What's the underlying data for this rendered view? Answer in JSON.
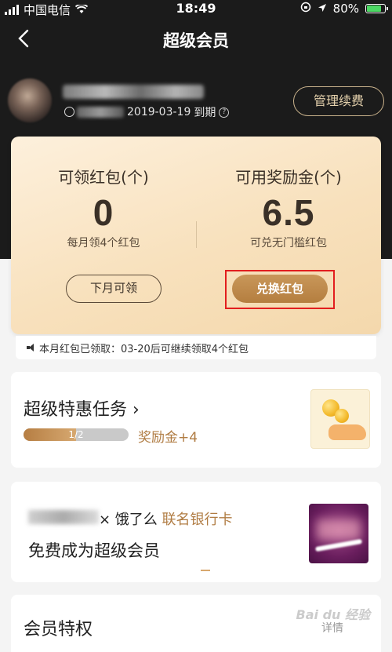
{
  "status_bar": {
    "carrier": "中国电信",
    "time": "18:49",
    "battery": "80%"
  },
  "nav": {
    "title": "超级会员"
  },
  "profile": {
    "expire_date": "2019-03-19",
    "expire_suffix": "到期",
    "manage_label": "管理续费"
  },
  "benefits": {
    "red_packets": {
      "title": "可领红包(个)",
      "value": "0",
      "subtitle": "每月领4个红包",
      "button": "下月可领"
    },
    "bonus": {
      "title": "可用奖励金(个)",
      "value": "6.5",
      "subtitle": "可兑无门槛红包",
      "button": "兑换红包"
    },
    "notice": "本月红包已领取：03-20后可继续领取4个红包"
  },
  "tasks": {
    "title": "超级特惠任务",
    "progress_label": "1/2",
    "progress_fraction": 0.5,
    "reward": "奖励金+4"
  },
  "bank": {
    "middle": "× 饿了么",
    "highlight": "联名银行卡",
    "subtitle": "免费成为超级会员"
  },
  "privileges": {
    "title": "会员特权",
    "more": "详情"
  },
  "watermark": "Bai du 经验",
  "colors": {
    "accent_gold": "#b47e3f",
    "highlight_red": "#e21e1e"
  }
}
